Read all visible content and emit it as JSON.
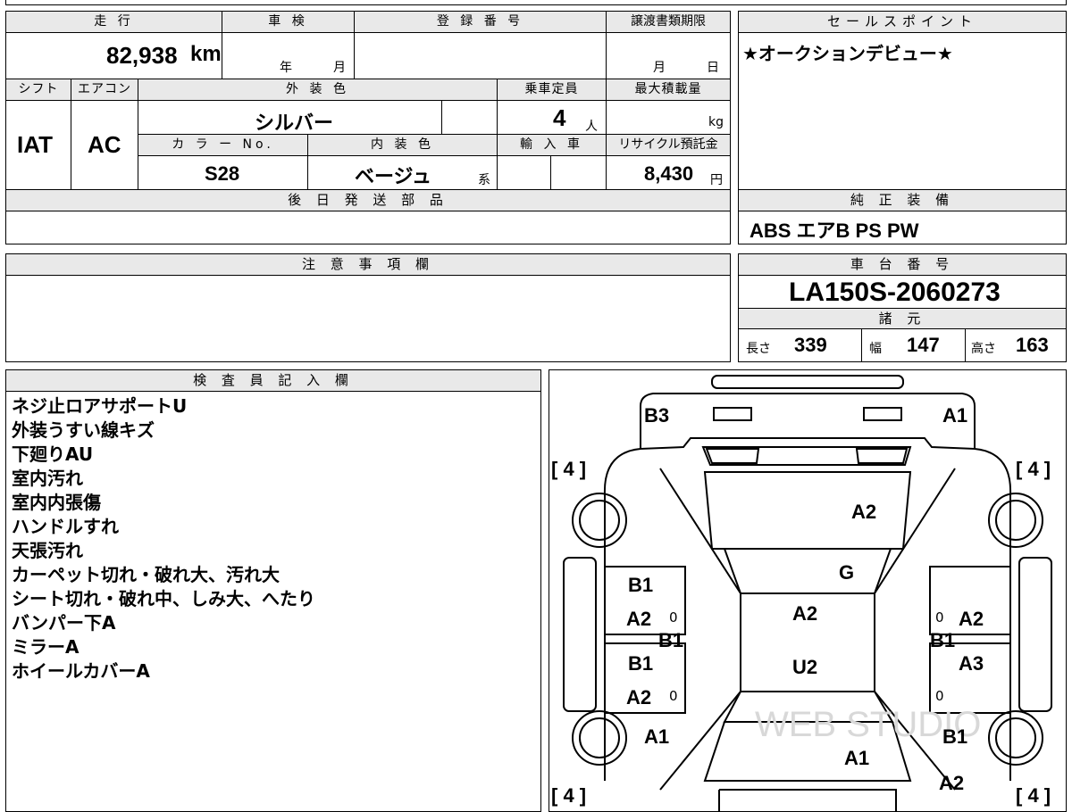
{
  "top": {
    "mileage_label": "走 行",
    "mileage_value": "82,938",
    "mileage_unit": "km",
    "inspection_label": "車 検",
    "inspection_year": "年",
    "inspection_month": "月",
    "registration_label": "登 録 番 号",
    "transfer_label": "譲渡書類期限",
    "transfer_month": "月",
    "transfer_day": "日",
    "shift_label": "シフト",
    "shift_value": "IAT",
    "ac_label": "エアコン",
    "ac_value": "AC",
    "exterior_color_label": "外 装 色",
    "exterior_color_value": "シルバー",
    "capacity_label": "乗車定員",
    "capacity_value": "4",
    "capacity_unit": "人",
    "max_load_label": "最大積載量",
    "max_load_unit": "kg",
    "color_no_label": "カ ラ ー No.",
    "color_no_value": "S28",
    "interior_color_label": "内 装 色",
    "interior_color_value": "ベージュ",
    "interior_color_suffix": "系",
    "import_label": "輸 入 車",
    "recycle_label": "リサイクル預託金",
    "recycle_value": "8,430",
    "recycle_unit": "円",
    "later_parts_label": "後 日 発 送 部 品"
  },
  "sales_point": {
    "label": "セールスポイント",
    "value": "★オークションデビュー★"
  },
  "genuine_equipment": {
    "label": "純 正 装 備",
    "value": "ABS エアB PS PW"
  },
  "notes": {
    "label": "注 意 事 項 欄"
  },
  "chassis": {
    "label": "車 台 番 号",
    "value": "LA150S-2060273",
    "specs_label": "諸 元",
    "length_label": "長さ",
    "length_value": "339",
    "width_label": "幅",
    "width_value": "147",
    "height_label": "高さ",
    "height_value": "163"
  },
  "inspector": {
    "label": "検 査 員 記 入 欄",
    "lines": [
      "ネジ止ロアサポートU",
      "外装うすい線キズ",
      "下廻りAU",
      "室内汚れ",
      "室内内張傷",
      "ハンドルすれ",
      "天張汚れ",
      "カーペット切れ・破れ大、汚れ大",
      "シート切れ・破れ中、しみ大、へたり",
      "バンパー下A",
      "ミラーA",
      "ホイールカバーA"
    ]
  },
  "diagram": {
    "tire_fl": "[ 4 ]",
    "tire_fr": "[ 4 ]",
    "tire_rl": "[ 4 ]",
    "tire_rr": "[ 4 ]",
    "b3": "B3",
    "a1_top": "A1",
    "a2_hood": "A2",
    "g_windshield": "G",
    "a2_roof": "A2",
    "u2_roof": "U2",
    "b1_left_front": "B1",
    "a2_left_front": "A2",
    "b1_left_mid": "B1",
    "b1_left_rear": "B1",
    "a2_left_rear": "A2",
    "a2_right_front": "A2",
    "b1_right_mid": "B1",
    "a3_right_rear": "A3",
    "a1_left_bottom": "A1",
    "b1_right_bottom": "B1",
    "a1_rear": "A1",
    "a2_right_bottom": "A2",
    "zero_1": "0",
    "zero_2": "0",
    "zero_3": "0",
    "zero_4": "0",
    "watermark": "WEB STUDIO"
  }
}
